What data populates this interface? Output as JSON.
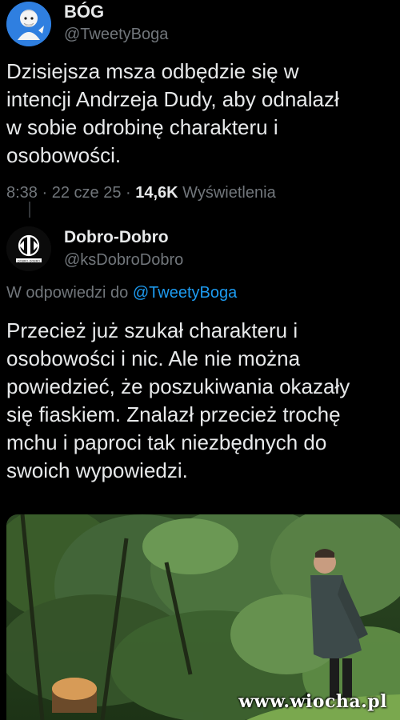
{
  "tweet1": {
    "display_name": "BÓG",
    "handle": "@TweetyBoga",
    "text_lines": [
      "Dzisiejsza msza odbędzie się w",
      "intencji Andrzeja Dudy, aby odnalazł",
      "w sobie odrobinę charakteru i",
      "osobowości."
    ],
    "time": "8:38",
    "sep1": " · ",
    "date": "22 cze 25",
    "sep2": " · ",
    "views_count": "14,6K",
    "views_label": " Wyświetlenia"
  },
  "tweet2": {
    "display_name": "Dobro-Dobro",
    "handle": "@ksDobroDobro",
    "reply_prefix": "W odpowiedzi do ",
    "reply_mention": "@TweetyBoga",
    "text_lines": [
      "Przecież już szukał charakteru i",
      "osobowości i nic. Ale nie można",
      "powiedzieć, że poszukiwania okazały",
      "się fiaskiem. Znalazł przecież trochę",
      "mchu i paproci tak niezbędnych do",
      "swoich wypowiedzi."
    ],
    "avatar_text": "DOBRO-DOBRO"
  },
  "watermark": "www.wiocha.pl",
  "colors": {
    "background": "#000000",
    "text_primary": "#e7e9ea",
    "text_secondary": "#71767b",
    "accent_link": "#1d9bf0"
  },
  "icons": {
    "avatar1": "cartoon-god-avatar",
    "avatar2": "dobro-dobro-logo-avatar"
  }
}
